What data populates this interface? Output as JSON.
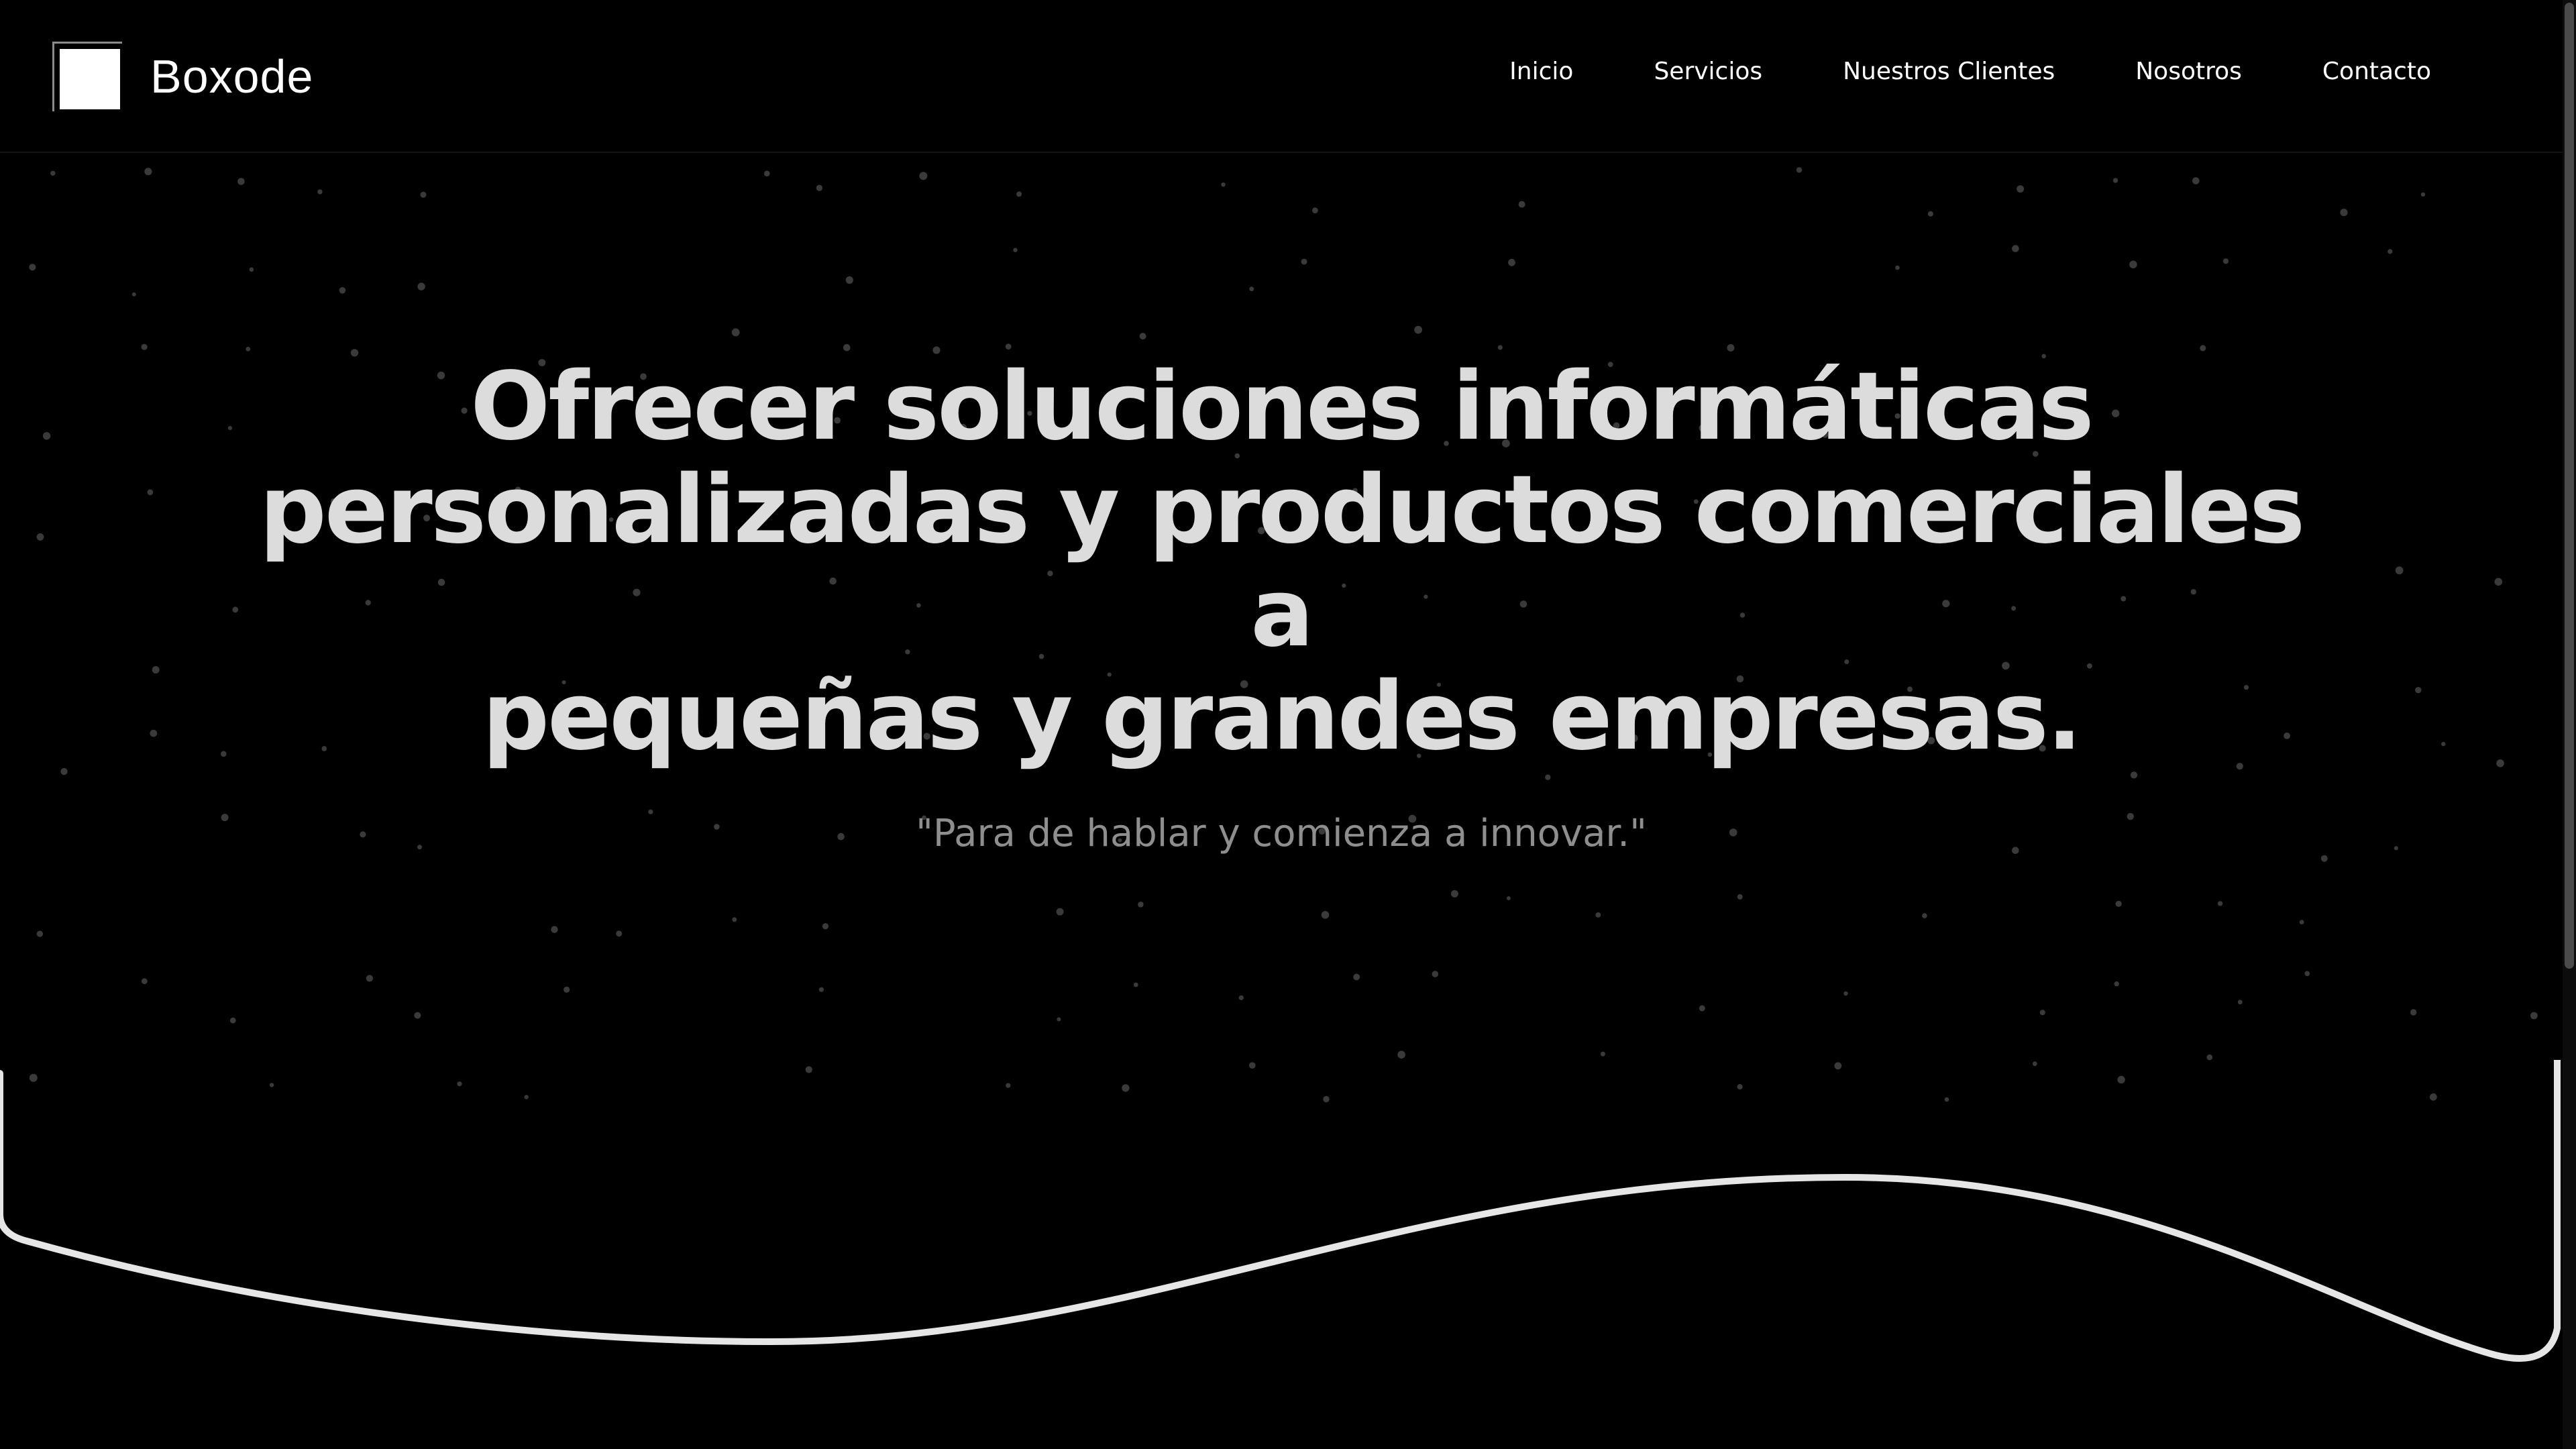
{
  "brand": {
    "name": "Boxode",
    "logo_icon": "white-square-logo-icon"
  },
  "nav": {
    "items": [
      {
        "label": "Inicio"
      },
      {
        "label": "Servicios"
      },
      {
        "label": "Nuestros Clientes"
      },
      {
        "label": "Nosotros"
      },
      {
        "label": "Contacto"
      }
    ]
  },
  "hero": {
    "title_lines": [
      "Ofrecer soluciones informáticas",
      "personalizadas y productos comerciales a",
      "pequeñas y grandes empresas."
    ],
    "quote": "\"Para de hablar y comienza a innovar.\""
  },
  "colors": {
    "background": "#000000",
    "text": "#ffffff",
    "title": "#dcdcdc",
    "quote": "#8e8e8e",
    "wave": "#e6e6e6"
  }
}
